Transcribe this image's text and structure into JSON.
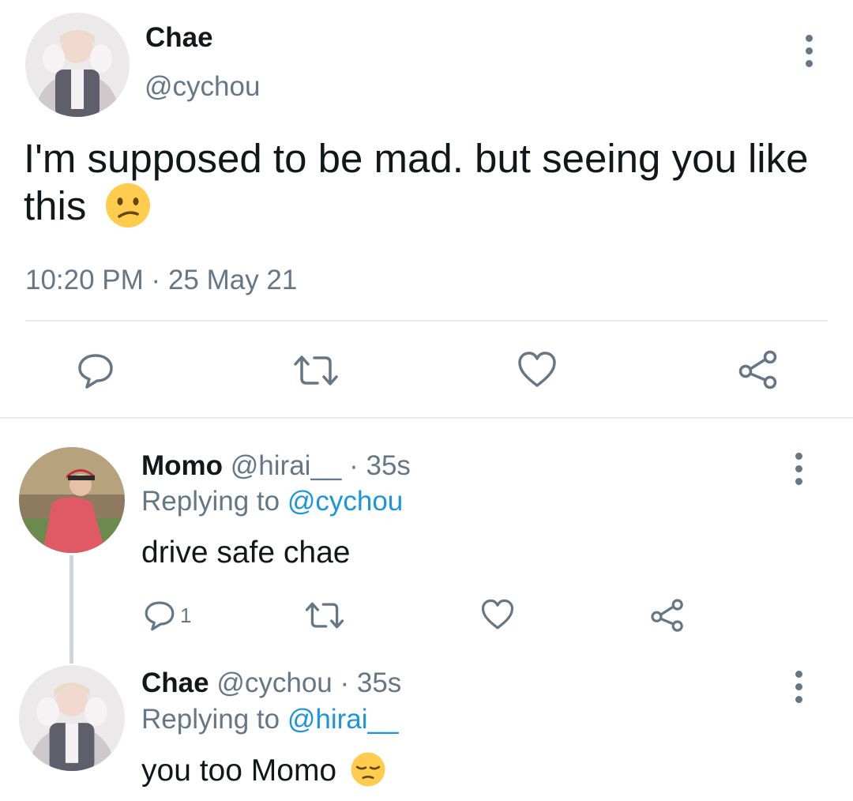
{
  "main_tweet": {
    "author_name": "Chae",
    "author_handle": "@cychou",
    "text": "I'm supposed to be mad. but seeing you like this",
    "emoji": "confused-face",
    "timestamp": "10:20 PM",
    "separator": "·",
    "date": "25 May 21"
  },
  "replies": [
    {
      "author_name": "Momo",
      "author_handle": "@hirai__",
      "meta": "· 35s",
      "replying_prefix": "Replying to",
      "replying_to": "@cychou",
      "text": "drive safe chae",
      "reply_count": "1"
    },
    {
      "author_name": "Chae",
      "author_handle": "@cychou",
      "meta": "· 35s",
      "replying_prefix": "Replying to",
      "replying_to": "@hirai__",
      "text": "you too Momo",
      "emoji": "pensive-face"
    }
  ],
  "colors": {
    "text": "#14171a",
    "secondary": "#657786",
    "link": "#1b95e0",
    "divider": "#e6ecf0",
    "emoji": "#ffcc4d"
  }
}
